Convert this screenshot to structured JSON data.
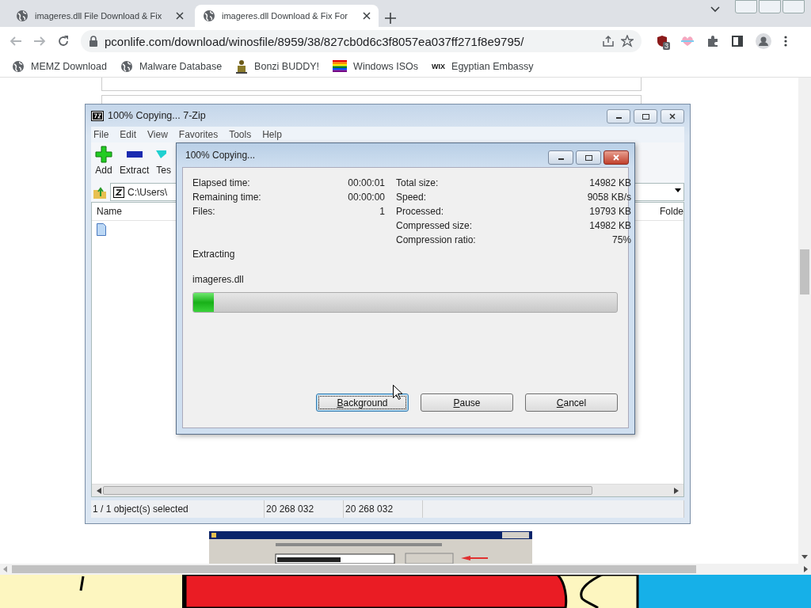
{
  "browser": {
    "tabs": [
      {
        "title": "imageres.dll File Download & Fix",
        "selected": false
      },
      {
        "title": "imageres.dll Download & Fix For",
        "selected": true
      }
    ],
    "url": "pconlife.com/download/winosfile/8959/38/827cb0d6c3f8057ea037ff271f8e9795/",
    "extension_badge": "3",
    "bookmarks": [
      {
        "kind": "globe",
        "label": "MEMZ Download"
      },
      {
        "kind": "globe",
        "label": "Malware Database"
      },
      {
        "kind": "figure",
        "label": "Bonzi BUDDY!"
      },
      {
        "kind": "flag",
        "label": "Windows ISOs"
      },
      {
        "kind": "logo",
        "logo_text": "WIX",
        "label": "Egyptian Embassy"
      }
    ]
  },
  "zip_window": {
    "title": "100% Copying... 7-Zip",
    "menu": [
      "File",
      "Edit",
      "View",
      "Favorites",
      "Tools",
      "Help"
    ],
    "toolbar": [
      {
        "kind": "add",
        "label": "Add"
      },
      {
        "kind": "extract",
        "label": "Extract"
      },
      {
        "kind": "test",
        "label": "Tes"
      }
    ],
    "path": "C:\\Users\\",
    "columns": [
      "Name",
      "Folde"
    ],
    "status": [
      "1 / 1 object(s) selected",
      "20 268 032",
      "20 268 032"
    ]
  },
  "dialog": {
    "title": "100% Copying...",
    "left_stats": [
      {
        "label": "Elapsed time:",
        "value": "00:00:01"
      },
      {
        "label": "Remaining time:",
        "value": "00:00:00"
      },
      {
        "label": "Files:",
        "value": "1"
      }
    ],
    "right_stats": [
      {
        "label": "Total size:",
        "value": "14982 KB"
      },
      {
        "label": "Speed:",
        "value": "9058 KB/s"
      },
      {
        "label": "Processed:",
        "value": "19793 KB"
      },
      {
        "label": "Compressed size:",
        "value": "14982 KB"
      },
      {
        "label": "Compression ratio:",
        "value": "75%"
      }
    ],
    "action": "Extracting",
    "file": "imageres.dll",
    "progress": {
      "level": 0.048
    },
    "buttons": [
      {
        "label": "Background",
        "selected": true
      },
      {
        "label": "Pause",
        "selected": false
      },
      {
        "label": "Cancel",
        "selected": false
      }
    ]
  }
}
